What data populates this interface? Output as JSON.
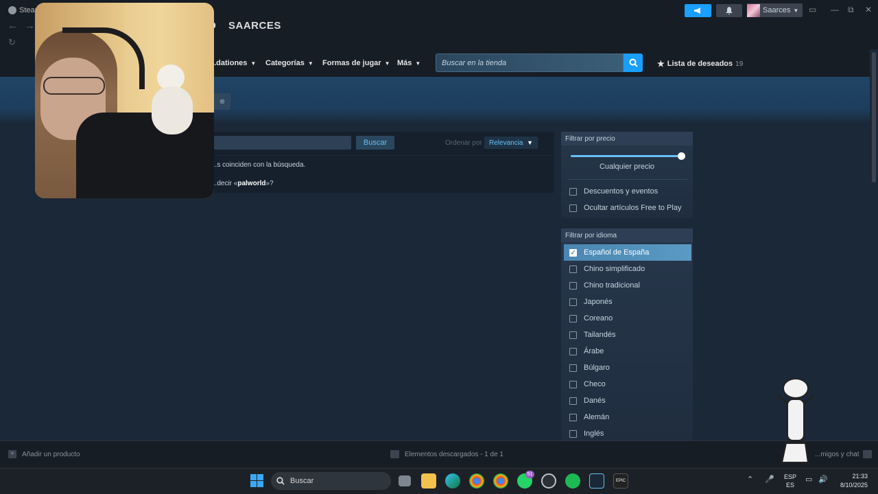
{
  "titlebar": {
    "app_name": "Steam",
    "brand_partial": "D",
    "username": "SAARCES",
    "user_menu_label": "Saarces"
  },
  "store_nav": {
    "items": [
      {
        "label": "...dationes"
      },
      {
        "label": "Categorías"
      },
      {
        "label": "Formas de jugar"
      },
      {
        "label": "Más"
      }
    ],
    "search_placeholder": "Buscar en la tienda",
    "wishlist_label": "Lista de deseados",
    "wishlist_count": "19"
  },
  "results": {
    "search_button": "Buscar",
    "sort_label": "Ordenar por",
    "sort_value": "Relevancia",
    "no_results_text": "...s coinciden con la búsqueda.",
    "suggestion_prefix": "...decir «",
    "suggestion_term": "palworld",
    "suggestion_suffix": "»?"
  },
  "price_filter": {
    "header": "Filtrar por precio",
    "slider_fraction": 1.0,
    "price_label": "Cualquier precio",
    "options": [
      {
        "label": "Descuentos y eventos",
        "checked": false
      },
      {
        "label": "Ocultar artículos Free to Play",
        "checked": false
      }
    ]
  },
  "language_filter": {
    "header": "Filtrar por idioma",
    "options": [
      {
        "label": "Español de España",
        "checked": true
      },
      {
        "label": "Chino simplificado",
        "checked": false
      },
      {
        "label": "Chino tradicional",
        "checked": false
      },
      {
        "label": "Japonés",
        "checked": false
      },
      {
        "label": "Coreano",
        "checked": false
      },
      {
        "label": "Tailandés",
        "checked": false
      },
      {
        "label": "Árabe",
        "checked": false
      },
      {
        "label": "Búlgaro",
        "checked": false
      },
      {
        "label": "Checo",
        "checked": false
      },
      {
        "label": "Danés",
        "checked": false
      },
      {
        "label": "Alemán",
        "checked": false
      },
      {
        "label": "Inglés",
        "checked": false
      }
    ]
  },
  "bottombar": {
    "add_product": "Añadir un producto",
    "downloads": "Elementos descargados - 1 de 1",
    "friends": "...migos y chat"
  },
  "taskbar": {
    "search_label": "Buscar",
    "whatsapp_badge": "51",
    "lang_top": "ESP",
    "lang_bottom": "ES",
    "time": "21:33",
    "date": "8/10/2025",
    "epic_label": "EPIC"
  },
  "colors": {
    "steam_bg": "#1b2838",
    "accent_blue": "#1a9fff",
    "link_blue": "#66c0f4",
    "titlebar": "#171d25"
  }
}
